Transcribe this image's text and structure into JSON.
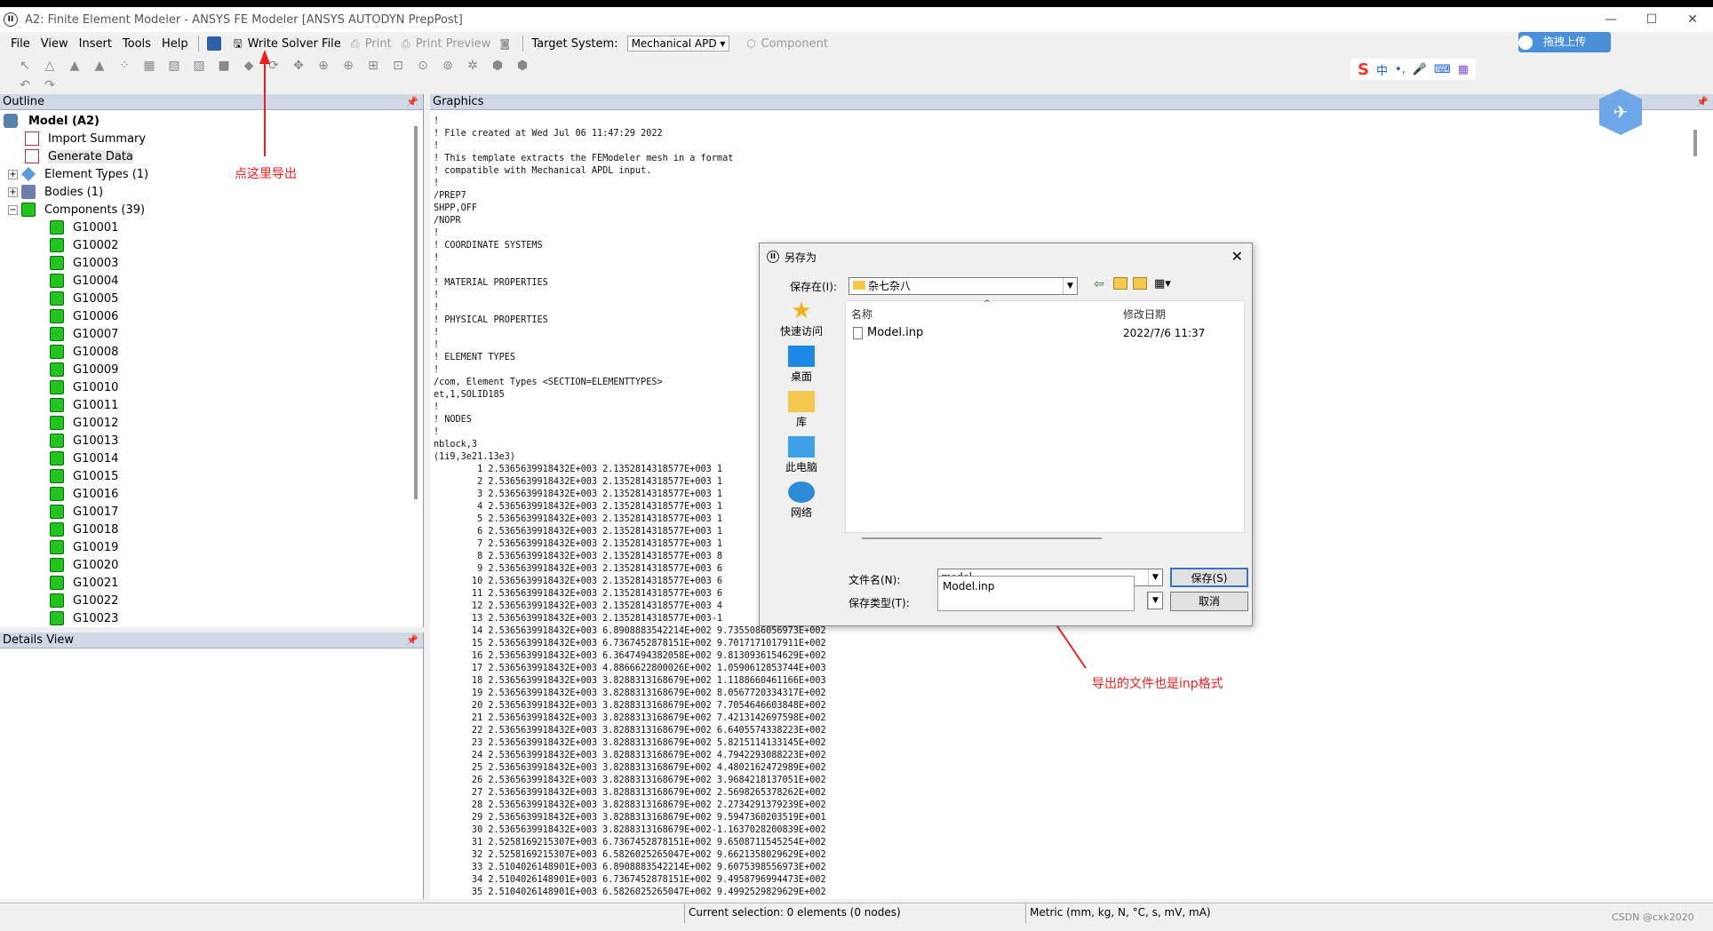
{
  "window": {
    "title": "A2: Finite Element Modeler - ANSYS FE Modeler [ANSYS AUTODYN PrepPost]",
    "app_icon_label": "II",
    "minimize": "—",
    "maximize": "☐",
    "close": "✕"
  },
  "menubar": {
    "file": "File",
    "view": "View",
    "insert": "Insert",
    "tools": "Tools",
    "help": "Help",
    "write_solver_file": "Write Solver File",
    "print": "Print",
    "print_preview": "Print Preview",
    "target_system_label": "Target System:",
    "target_system_value": "Mechanical APD",
    "component": "Component"
  },
  "outline": {
    "header": "Outline",
    "root": "Model (A2)",
    "items": [
      "Import Summary",
      "Generate Data",
      "Element Types (1)",
      "Bodies (1)",
      "Components (39)"
    ],
    "components": [
      "G10001",
      "G10002",
      "G10003",
      "G10004",
      "G10005",
      "G10006",
      "G10007",
      "G10008",
      "G10009",
      "G10010",
      "G10011",
      "G10012",
      "G10013",
      "G10014",
      "G10015",
      "G10016",
      "G10017",
      "G10018",
      "G10019",
      "G10020",
      "G10021",
      "G10022",
      "G10023"
    ]
  },
  "details": {
    "header": "Details View"
  },
  "graphics": {
    "header": "Graphics",
    "lines": [
      "!",
      "! File created at Wed Jul 06 11:47:29 2022",
      "!",
      "! This template extracts the FEModeler mesh in a format",
      "! compatible with Mechanical APDL input.",
      "!",
      "/PREP7",
      "SHPP,OFF",
      "/NOPR",
      "!",
      "! COORDINATE SYSTEMS",
      "!",
      "!",
      "! MATERIAL PROPERTIES",
      "!",
      "!",
      "! PHYSICAL PROPERTIES",
      "!",
      "!",
      "! ELEMENT TYPES",
      "!",
      "/com, Element Types <SECTION=ELEMENTTYPES>",
      "et,1,SOLID185",
      "!",
      "! NODES",
      "!",
      "nblock,3",
      "(1i9,3e21.13e3)",
      "        1 2.5365639918432E+003 2.1352814318577E+003 1",
      "        2 2.5365639918432E+003 2.1352814318577E+003 1",
      "        3 2.5365639918432E+003 2.1352814318577E+003 1",
      "        4 2.5365639918432E+003 2.1352814318577E+003 1",
      "        5 2.5365639918432E+003 2.1352814318577E+003 1",
      "        6 2.5365639918432E+003 2.1352814318577E+003 1",
      "        7 2.5365639918432E+003 2.1352814318577E+003 1",
      "        8 2.5365639918432E+003 2.1352814318577E+003 8",
      "        9 2.5365639918432E+003 2.1352814318577E+003 6",
      "       10 2.5365639918432E+003 2.1352814318577E+003 6",
      "       11 2.5365639918432E+003 2.1352814318577E+003 6",
      "       12 2.5365639918432E+003 2.1352814318577E+003 4",
      "       13 2.5365639918432E+003 2.1352814318577E+003-1",
      "       14 2.5365639918432E+003 6.8908883542214E+002 9.7355086056973E+002",
      "       15 2.5365639918432E+003 6.7367452878151E+002 9.7017171017911E+002",
      "       16 2.5365639918432E+003 6.3647494382058E+002 9.8130936154629E+002",
      "       17 2.5365639918432E+003 4.8866622800026E+002 1.0590612853744E+003",
      "       18 2.5365639918432E+003 3.8288313168679E+002 1.1188660461166E+003",
      "       19 2.5365639918432E+003 3.8288313168679E+002 8.0567720334317E+002",
      "       20 2.5365639918432E+003 3.8288313168679E+002 7.7054646603848E+002",
      "       21 2.5365639918432E+003 3.8288313168679E+002 7.4213142697598E+002",
      "       22 2.5365639918432E+003 3.8288313168679E+002 6.6405574338223E+002",
      "       23 2.5365639918432E+003 3.8288313168679E+002 5.8215114133145E+002",
      "       24 2.5365639918432E+003 3.8288313168679E+002 4.7942293088223E+002",
      "       25 2.5365639918432E+003 3.8288313168679E+002 4.4802162472989E+002",
      "       26 2.5365639918432E+003 3.8288313168679E+002 3.9684218137051E+002",
      "       27 2.5365639918432E+003 3.8288313168679E+002 2.5698265378262E+002",
      "       28 2.5365639918432E+003 3.8288313168679E+002 2.2734291379239E+002",
      "       29 2.5365639918432E+003 3.8288313168679E+002 9.5947360203519E+001",
      "       30 2.5365639918432E+003 3.8288313168679E+002-1.1637028200839E+002",
      "       31 2.5258169215307E+003 6.7367452878151E+002 9.6508711545254E+002",
      "       32 2.5258169215307E+003 6.5826025265047E+002 9.6621358029629E+002",
      "       33 2.5104026148901E+003 6.8908883542214E+002 9.6075398556973E+002",
      "       34 2.5104026148901E+003 6.7367452878151E+002 9.4958796994473E+002",
      "       35 2.5104026148901E+003 6.5826025265047E+002 9.4992529829629E+002"
    ]
  },
  "status": {
    "selection": "Current selection: 0 elements (0 nodes)",
    "units": "Metric (mm, kg, N, °C, s, mV, mA)"
  },
  "dialog": {
    "title": "另存为",
    "save_in_label": "保存在(I):",
    "save_in_value": "杂七杂八",
    "places": [
      "快速访问",
      "桌面",
      "库",
      "此电脑",
      "网络"
    ],
    "col_name": "名称",
    "col_modified": "修改日期",
    "files": [
      {
        "name": "Model.inp",
        "modified": "2022/7/6 11:37"
      }
    ],
    "filename_label": "文件名(N):",
    "filename_value": "model",
    "filetype_label": "保存类型(T):",
    "save_button": "保存(S)",
    "cancel_button": "取消",
    "autocomplete": "Model.inp",
    "close": "✕"
  },
  "annotations": {
    "export_here": "点这里导出",
    "inp_format": "导出的文件也是inp格式"
  },
  "overlays": {
    "upload": "拖拽上传",
    "ime": [
      "S",
      "中",
      "•,",
      "🎤",
      "⌨",
      "▦"
    ]
  },
  "watermark": "CSDN @cxk2020"
}
